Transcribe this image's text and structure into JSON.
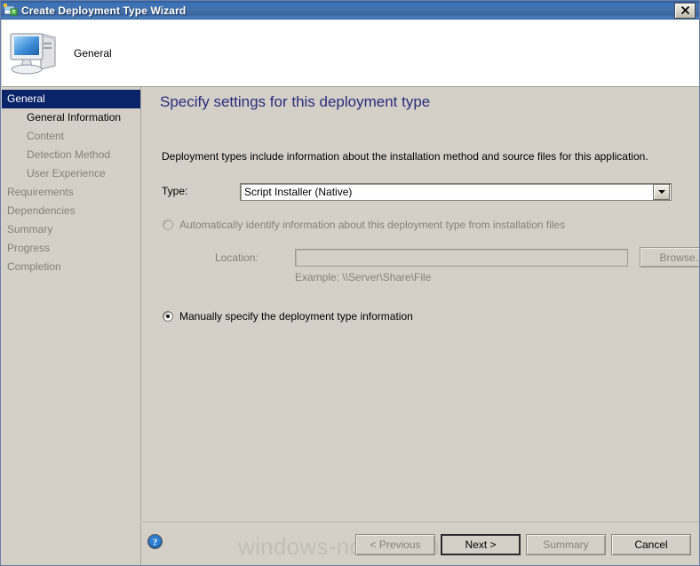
{
  "window": {
    "title": "Create Deployment Type Wizard",
    "title_icon": "wizard-app-icon",
    "close_label": "Close"
  },
  "header": {
    "icon": "computer-monitor-icon",
    "title": "General"
  },
  "sidebar": {
    "items": [
      {
        "label": "General",
        "level": "top",
        "state": "selected"
      },
      {
        "label": "General Information",
        "level": "sub",
        "state": "enabled"
      },
      {
        "label": "Content",
        "level": "sub",
        "state": "disabled"
      },
      {
        "label": "Detection Method",
        "level": "sub",
        "state": "disabled"
      },
      {
        "label": "User Experience",
        "level": "sub",
        "state": "disabled"
      },
      {
        "label": "Requirements",
        "level": "top",
        "state": "disabled"
      },
      {
        "label": "Dependencies",
        "level": "top",
        "state": "disabled"
      },
      {
        "label": "Summary",
        "level": "top",
        "state": "disabled"
      },
      {
        "label": "Progress",
        "level": "top",
        "state": "disabled"
      },
      {
        "label": "Completion",
        "level": "top",
        "state": "disabled"
      }
    ]
  },
  "main": {
    "heading": "Specify settings for this deployment type",
    "intro": "Deployment types include information about the installation method and source files for this application.",
    "type_label": "Type:",
    "type_value": "Script Installer (Native)",
    "type_dropdown_icon": "chevron-down-icon",
    "radio_auto_label": "Automatically identify information about this deployment type from installation files",
    "radio_auto_checked": false,
    "radio_auto_enabled": false,
    "location_label": "Location:",
    "location_value": "",
    "location_placeholder": "",
    "browse_label": "Browse...",
    "example_text": "Example: \\\\Server\\Share\\File",
    "radio_manual_label": "Manually specify the deployment type information",
    "radio_manual_checked": true
  },
  "footer": {
    "help_icon": "help-question-icon",
    "watermark": "windows-noob.com",
    "buttons": [
      {
        "label": "< Previous",
        "state": "disabled"
      },
      {
        "label": "Next >",
        "state": "default"
      },
      {
        "label": "Summary",
        "state": "disabled"
      },
      {
        "label": "Cancel",
        "state": "enabled"
      }
    ]
  },
  "colors": {
    "titlebar_blue": "#3f74b8",
    "selection_blue": "#0a246a",
    "heading_purple": "#2c2c7c",
    "dialog_face": "#d4d0c8",
    "disabled_text": "#868278",
    "watermark_gray": "#c2bfb6"
  }
}
